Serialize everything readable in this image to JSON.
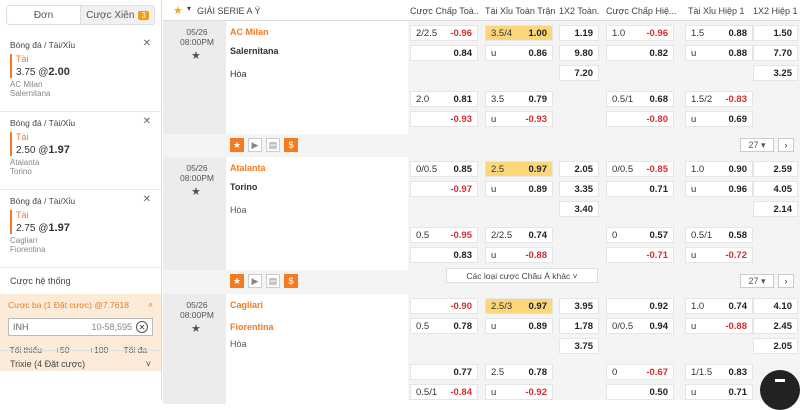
{
  "sidebar": {
    "tab_single": "Đơn",
    "tab_combo": "Cược Xiên",
    "combo_count": "3",
    "bets": [
      {
        "type": "Bóng đá / Tài/Xỉu",
        "selection": "Tài",
        "line": "3.75",
        "odds": "2.00",
        "team1": "AC Milan",
        "team2": "Salernitana"
      },
      {
        "type": "Bóng đá / Tài/Xỉu",
        "selection": "Tài",
        "line": "2.50",
        "odds": "1.97",
        "team1": "Atalanta",
        "team2": "Torino"
      },
      {
        "type": "Bóng đá / Tài/Xỉu",
        "selection": "Tài",
        "line": "2.75",
        "odds": "1.97",
        "team1": "Cagliari",
        "team2": "Fiorentina"
      }
    ],
    "system_label": "Cược hệ thống",
    "combo_title": "Cược ba (1 Đặt cược) @7.7618",
    "currency": "INH",
    "stake_placeholder": "10-58,595",
    "quick": [
      "Tối thiểu",
      "+50",
      "+100",
      "Tối đa"
    ],
    "trixie": "Trixie (4 Đặt cược)"
  },
  "header": {
    "league": "GIẢI SERIE A Ý",
    "cols": [
      "Cược Chấp Toà...",
      "Tài Xỉu Toàn Trận",
      "1X2 Toàn...",
      "Cược Chấp Hiệ...",
      "Tài Xỉu Hiệp 1",
      "1X2 Hiệp 1"
    ]
  },
  "matches": [
    {
      "date": "05/26",
      "time": "08:00PM",
      "home": "AC Milan",
      "away": "Salernitana",
      "draw": "Hòa",
      "rows": [
        [
          [
            "2/2.5",
            "-0.96"
          ],
          [
            "3.5/4",
            "1.00"
          ],
          [
            "",
            "1.19"
          ],
          [
            "1.0",
            "-0.96"
          ],
          [
            "1.5",
            "0.88"
          ],
          [
            "",
            "1.50"
          ]
        ],
        [
          [
            "",
            "0.84"
          ],
          [
            "u",
            "0.86"
          ],
          [
            "",
            "9.80"
          ],
          [
            "",
            "0.82"
          ],
          [
            "u",
            "0.88"
          ],
          [
            "",
            "7.70"
          ]
        ],
        [
          null,
          null,
          [
            "",
            "7.20"
          ],
          null,
          null,
          [
            "",
            "3.25"
          ]
        ],
        [
          [
            "2.0",
            "0.81"
          ],
          [
            "3.5",
            "0.79"
          ],
          null,
          [
            "0.5/1",
            "0.68"
          ],
          [
            "1.5/2",
            "-0.83"
          ],
          null
        ],
        [
          [
            "",
            "-0.93"
          ],
          [
            "u",
            "-0.93"
          ],
          null,
          [
            "",
            "-0.80"
          ],
          [
            "u",
            "0.69"
          ],
          null
        ]
      ],
      "more": "27"
    },
    {
      "date": "05/26",
      "time": "08:00PM",
      "home": "Atalanta",
      "away": "Torino",
      "draw": "Hòa",
      "rows": [
        [
          [
            "0/0.5",
            "0.85"
          ],
          [
            "2.5",
            "0.97"
          ],
          [
            "",
            "2.05"
          ],
          [
            "0/0.5",
            "-0.85"
          ],
          [
            "1.0",
            "0.90"
          ],
          [
            "",
            "2.59"
          ]
        ],
        [
          [
            "",
            "-0.97"
          ],
          [
            "u",
            "0.89"
          ],
          [
            "",
            "3.35"
          ],
          [
            "",
            "0.71"
          ],
          [
            "u",
            "0.96"
          ],
          [
            "",
            "4.05"
          ]
        ],
        [
          null,
          null,
          [
            "",
            "3.40"
          ],
          null,
          null,
          [
            "",
            "2.14"
          ]
        ],
        [
          [
            "0.5",
            "-0.95"
          ],
          [
            "2/2.5",
            "0.74"
          ],
          null,
          [
            "0",
            "0.57"
          ],
          [
            "0.5/1",
            "0.58"
          ],
          null
        ],
        [
          [
            "",
            "0.83"
          ],
          [
            "u",
            "-0.88"
          ],
          null,
          [
            "",
            "-0.71"
          ],
          [
            "u",
            "-0.72"
          ],
          null
        ]
      ],
      "more": "27",
      "asian": "Các loại cược Châu Á khác"
    },
    {
      "date": "05/26",
      "time": "08:00PM",
      "home": "Cagliari",
      "away": "Fiorentina",
      "draw": "Hòa",
      "rows": [
        [
          [
            "",
            "-0.90"
          ],
          [
            "2.5/3",
            "0.97"
          ],
          [
            "",
            "3.95"
          ],
          [
            "",
            "0.92"
          ],
          [
            "1.0",
            "0.74"
          ],
          [
            "",
            "4.10"
          ]
        ],
        [
          [
            "0.5",
            "0.78"
          ],
          [
            "u",
            "0.89"
          ],
          [
            "",
            "1.78"
          ],
          [
            "0/0.5",
            "0.94"
          ],
          [
            "u",
            "-0.88"
          ],
          [
            "",
            "2.45"
          ]
        ],
        [
          null,
          null,
          [
            "",
            "3.75"
          ],
          null,
          null,
          [
            "",
            "2.05"
          ]
        ],
        [
          [
            "",
            "0.77"
          ],
          [
            "2.5",
            "0.78"
          ],
          null,
          [
            "0",
            "-0.67"
          ],
          [
            "1/1.5",
            "0.83"
          ],
          null
        ],
        [
          [
            "0.5/1",
            "-0.84"
          ],
          [
            "u",
            "-0.92"
          ],
          null,
          [
            "",
            "0.50"
          ],
          [
            "u",
            "0.71"
          ],
          null
        ]
      ]
    }
  ]
}
